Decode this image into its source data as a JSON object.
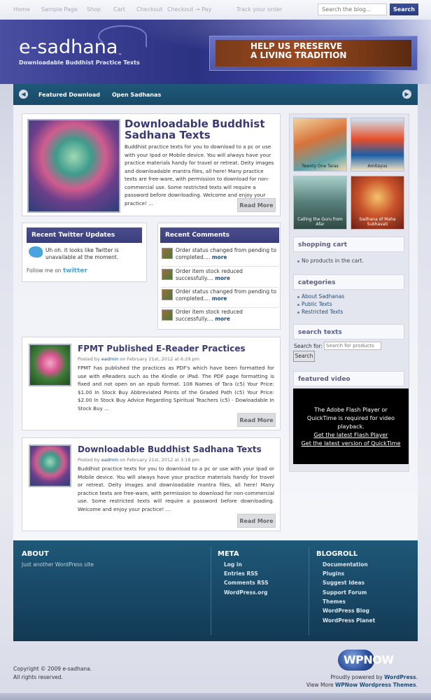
{
  "topnav": {
    "items": [
      "Home",
      "Sample Page",
      "Shop",
      "Cart",
      "Checkout",
      "Checkout → Pay",
      "Track your order"
    ],
    "search_placeholder": "Search the blog...",
    "search_button": "Search"
  },
  "header": {
    "logo": "e-sadhana",
    "trademark": "™",
    "tagline": "Downloadable Buddhist Practice Texts",
    "banner_text": [
      "HELP US PRESERVE",
      "A LIVING TRADITION"
    ]
  },
  "mainnav": {
    "items": [
      "Featured Download",
      "Open Sadhanas"
    ]
  },
  "featured": {
    "title": "Downloadable Buddhist Sadhana Texts",
    "text": "Buddhist practice texts for you to download to a pc or use with your Ipad or Mobile device. You will always have your practice materials handy for travel or retreat. Deity images and downloadable mantra files, all here! Many practice texts are free-ware, with permission to download for non-commercial use. Some restricted texts will require a password before downloading. Welcome and enjoy your practice! ...",
    "more": "Read More"
  },
  "twitter": {
    "title": "Recent Twitter Updates",
    "message": "Uh oh. it looks like Twitter is unavailable at the moment.",
    "follow": "Follow me on",
    "brand": "twitter"
  },
  "comments": {
    "title": "Recent Comments",
    "items": [
      {
        "text": "Order status changed from pending to completed....",
        "more": "more"
      },
      {
        "text": "Order item stock reduced successfully....",
        "more": "more"
      },
      {
        "text": "Order status changed from pending to completed....",
        "more": "more"
      },
      {
        "text": "Order item stock reduced successfully....",
        "more": "more"
      }
    ]
  },
  "posts": [
    {
      "title": "FPMT Published E-Reader Practices",
      "meta_prefix": "Posted by",
      "author": "eadmin",
      "date": "on February 21st, 2012 at 6:29 pm",
      "text": "FPMT has published the practices as PDF's which have been formatted for use with eReaders such as the Kindle or iPad. The PDF page formatting is fixed and not open on an epub format. 108 Names of Tara (c5) Your Price: $1.00 In Stock Buy Abbreviated Points of the Graded Path (c5) Your Price: $2.00 In Stock Buy Advice Regarding Spiritual Teachers (c5) - Dowloadable In Stock Buy ...",
      "more": "Read More"
    },
    {
      "title": "Downloadable Buddhist Sadhana Texts",
      "meta_prefix": "Posted by",
      "author": "eadmin",
      "date": "on February 21st, 2012 at 3:18 pm",
      "text": "Buddhist practice texts for you to download to a pc or use with your Ipad or Mobile device. You will always have your practice materials handy for travel or retreat. Deity images and downloadable mantra files, all here! Many practice texts are free-ware, with permission to download for non-commercial use. Some restricted texts will require a password before downloading. Welcome and enjoy your practice! ...",
      "more": "Read More"
    }
  ],
  "sidebar": {
    "thumbs": [
      {
        "caption": "Twenty One Taras"
      },
      {
        "caption": "Amitayus"
      },
      {
        "caption": "Calling the Guru from Afar"
      },
      {
        "caption": "Sadhana of Maha Sukhavati"
      }
    ],
    "cart_title": "shopping cart",
    "cart_empty": "No products in the cart.",
    "categories_title": "categories",
    "categories": [
      "About Sadhanas",
      "Public Texts",
      "Restricted Texts"
    ],
    "search_title": "search texts",
    "search_label": "Search for:",
    "search_placeholder": "Search for products",
    "search_button": "Search",
    "video_title": "featured video",
    "video_text": "The Adobe Flash Player or QuickTime is required for video playback.",
    "video_link1": "Get the latest Flash Player",
    "video_link2": "Get the latest version of QuickTime"
  },
  "footer": {
    "about_title": "ABOUT",
    "about_text": "Just another WordPress site",
    "meta_title": "META",
    "meta_links": [
      "Log in",
      "Entries RSS",
      "Comments RSS",
      "WordPress.org"
    ],
    "blogroll_title": "BLOGROLL",
    "blogroll_links": [
      "Documentation",
      "Plugins",
      "Suggest Ideas",
      "Support Forum",
      "Themes",
      "WordPress Blog",
      "WordPress Planet"
    ]
  },
  "bottom": {
    "copyright": "Copyright © 2009 e-sadhana.",
    "rights": "All rights reserved.",
    "powered_prefix": "Proudly powered by",
    "powered_link": "WordPress",
    "view_prefix": "View More",
    "view_link": "WPNow Wordpress Themes",
    "logo_text": "WPNOW"
  }
}
